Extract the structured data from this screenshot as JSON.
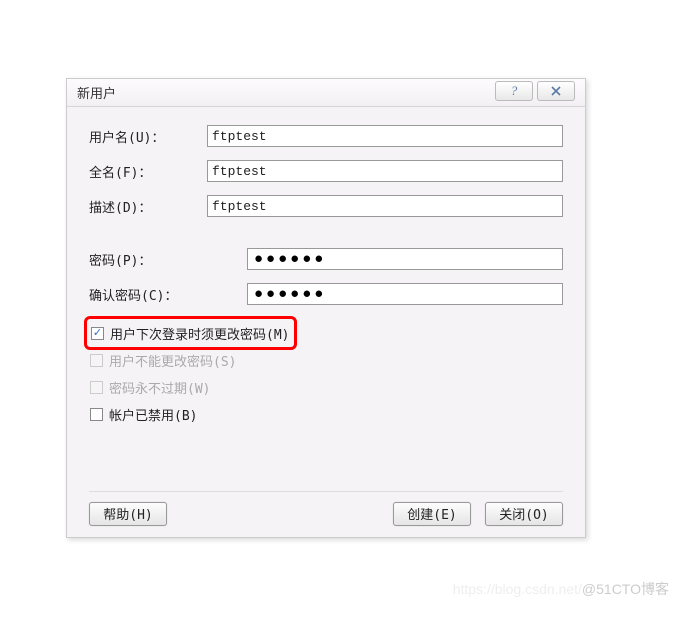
{
  "dialog": {
    "title": "新用户",
    "fields": {
      "username_label": "用户名(U)：",
      "username_value": "ftptest",
      "fullname_label": "全名(F)：",
      "fullname_value": "ftptest",
      "description_label": "描述(D)：",
      "description_value": "ftptest",
      "password_label": "密码(P)：",
      "password_value": "●●●●●●",
      "confirm_password_label": "确认密码(C)：",
      "confirm_password_value": "●●●●●●"
    },
    "checkboxes": {
      "must_change_pw": {
        "label": "用户下次登录时须更改密码(M)",
        "checked": true,
        "enabled": true
      },
      "cannot_change_pw": {
        "label": "用户不能更改密码(S)",
        "checked": false,
        "enabled": false
      },
      "pw_never_expires": {
        "label": "密码永不过期(W)",
        "checked": false,
        "enabled": false
      },
      "account_disabled": {
        "label": "帐户已禁用(B)",
        "checked": false,
        "enabled": true
      }
    },
    "buttons": {
      "help": "帮助(H)",
      "create": "创建(E)",
      "close": "关闭(O)"
    }
  },
  "watermark": {
    "left": "https://blog.csdn.net/",
    "right": "@51CTO博客"
  }
}
